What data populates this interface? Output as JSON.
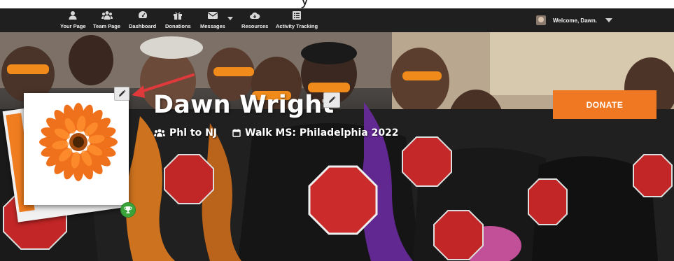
{
  "nav": {
    "items": [
      {
        "label": "Your Page",
        "icon": "user-icon"
      },
      {
        "label": "Team Page",
        "icon": "team-icon"
      },
      {
        "label": "Dashboard",
        "icon": "dashboard-icon"
      },
      {
        "label": "Donations",
        "icon": "gift-icon"
      },
      {
        "label": "Messages",
        "icon": "envelope-icon"
      },
      {
        "label": "Resources",
        "icon": "cloud-icon"
      },
      {
        "label": "Activity Tracking",
        "icon": "list-icon"
      }
    ],
    "welcome": "Welcome, Dawn."
  },
  "profile": {
    "name": "Dawn Wright",
    "team": "Phl to NJ",
    "event": "Walk MS: Philadelphia 2022"
  },
  "actions": {
    "donate_label": "DONATE"
  },
  "colors": {
    "navbar_bg": "#1f1f1f",
    "donate_bg": "#f07822",
    "badge_green": "#3aa33a",
    "annotation_arrow": "#e0393b"
  }
}
